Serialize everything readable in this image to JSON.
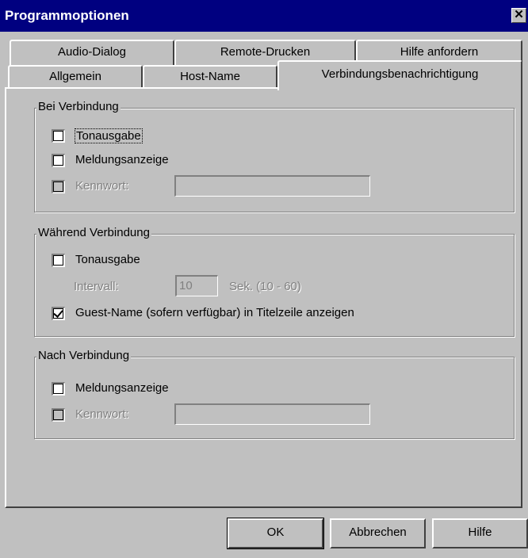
{
  "window": {
    "title": "Programmoptionen",
    "close_glyph": "✕"
  },
  "tabs_back": [
    "Audio-Dialog",
    "Remote-Drucken",
    "Hilfe anfordern"
  ],
  "tabs_front": [
    "Allgemein",
    "Host-Name",
    "Verbindungsbenachrichtigung"
  ],
  "active_tab": "Verbindungsbenachrichtigung",
  "groups": {
    "bei": {
      "title": "Bei Verbindung",
      "tonausgabe": "Tonausgabe",
      "meldungsanzeige": "Meldungsanzeige",
      "kennwort": "Kennwort:",
      "kennwort_value": ""
    },
    "waehrend": {
      "title": "Während Verbindung",
      "tonausgabe": "Tonausgabe",
      "intervall_label": "Intervall:",
      "intervall_value": "10",
      "intervall_unit": "Sek. (10 - 60)",
      "guest_name": "Guest-Name (sofern verfügbar) in Titelzeile anzeigen",
      "guest_name_checked": true
    },
    "nach": {
      "title": "Nach Verbindung",
      "meldungsanzeige": "Meldungsanzeige",
      "kennwort": "Kennwort:",
      "kennwort_value": ""
    }
  },
  "buttons": {
    "ok": "OK",
    "cancel": "Abbrechen",
    "help": "Hilfe"
  }
}
